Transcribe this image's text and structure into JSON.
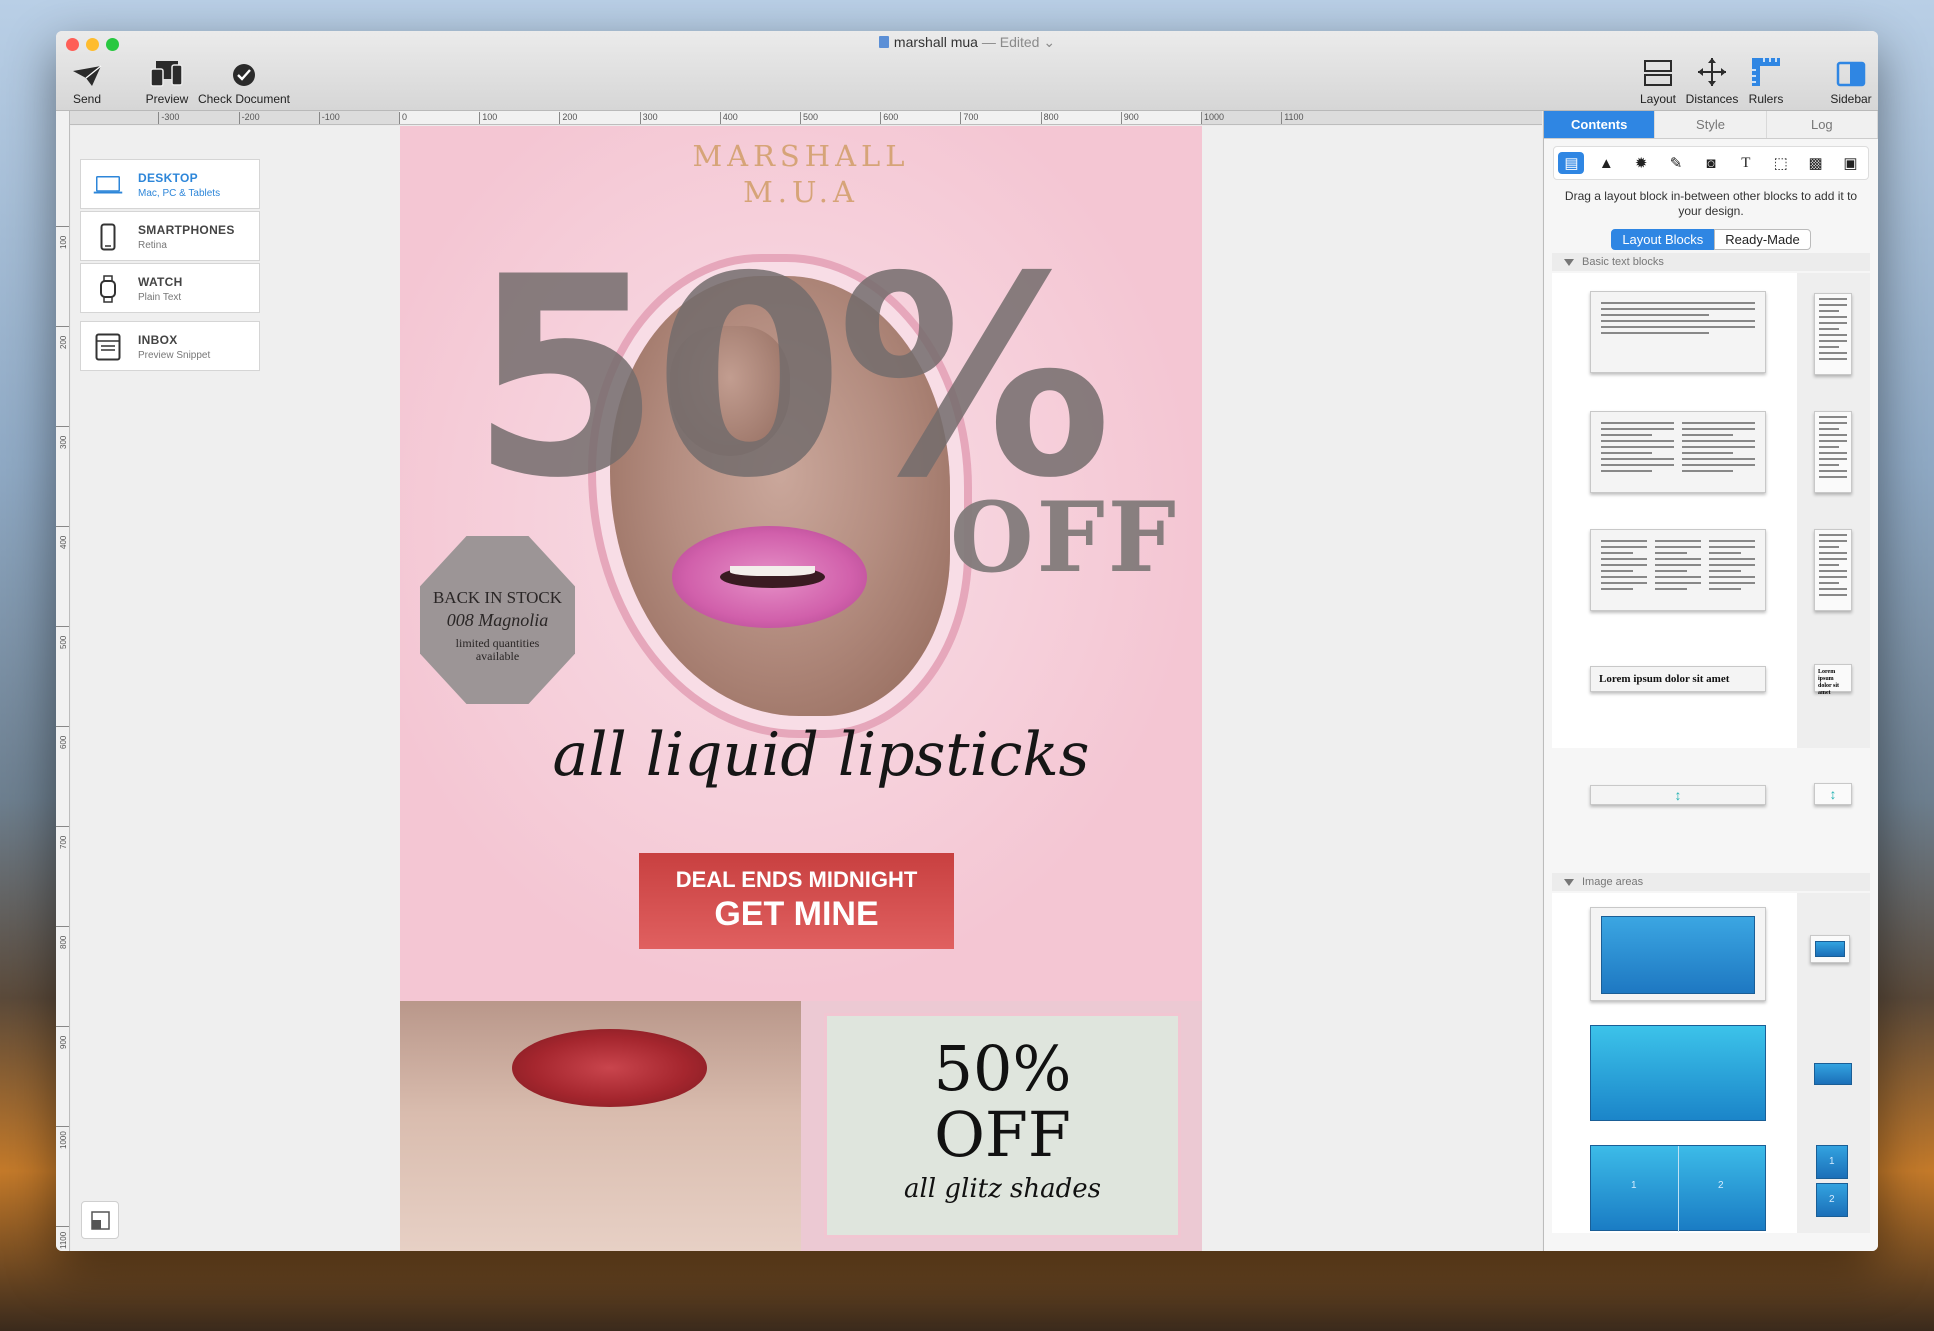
{
  "window": {
    "title": "marshall mua",
    "edited": " — Edited",
    "colors": {
      "close": "#fe5f57",
      "minimize": "#febc2e",
      "zoom": "#28c840",
      "accent": "#2f86e3"
    }
  },
  "toolbar": {
    "left": [
      {
        "label": "Send",
        "icon": "send-icon"
      },
      {
        "label": "Preview",
        "icon": "preview-icon"
      },
      {
        "label": "Check Document",
        "icon": "check-icon"
      }
    ],
    "right": [
      {
        "label": "Layout",
        "icon": "layout-icon"
      },
      {
        "label": "Distances",
        "icon": "distances-icon"
      },
      {
        "label": "Rulers",
        "icon": "rulers-icon"
      },
      {
        "label": "Sidebar",
        "icon": "sidebar-icon"
      }
    ]
  },
  "ruler": {
    "h_ticks": [
      "-300",
      "-200",
      "-100",
      "0",
      "100",
      "200",
      "300",
      "400",
      "500",
      "600",
      "700",
      "800",
      "900",
      "1000",
      "1100"
    ],
    "v_ticks": [
      "100",
      "200",
      "300",
      "400",
      "500",
      "600",
      "700",
      "800",
      "900",
      "1000",
      "1100"
    ]
  },
  "devices": [
    {
      "name": "DESKTOP",
      "sub": "Mac, PC & Tablets",
      "icon": "laptop-icon",
      "active": true
    },
    {
      "name": "SMARTPHONES",
      "sub": "Retina",
      "icon": "smartphone-icon"
    },
    {
      "name": "WATCH",
      "sub": "Plain Text",
      "icon": "watch-icon"
    },
    {
      "name": "INBOX",
      "sub": "Preview Snippet",
      "icon": "inbox-icon"
    }
  ],
  "email": {
    "brand_line1": "MARSHALL",
    "brand_line2": "M.U.A",
    "big_percent": "50%",
    "off": "OFF",
    "badge_line1": "BACK IN STOCK",
    "badge_line2": "008 Magnolia",
    "badge_line3": "limited quantities",
    "badge_line4": "available",
    "script": "all liquid lipsticks",
    "cta_line1": "DEAL ENDS MIDNIGHT",
    "cta_line2": "GET MINE",
    "promo_line1": "50%",
    "promo_line2": "OFF",
    "promo_line3": "all glitz shades"
  },
  "sidebar": {
    "tabs": [
      "Contents",
      "Style",
      "Log"
    ],
    "icons": [
      "layout-block-icon",
      "shape-icon",
      "badge-icon",
      "brush-icon",
      "image-icon",
      "text-icon",
      "selection-icon",
      "pattern-icon",
      "picture-icon"
    ],
    "help": "Drag a layout block in-between other blocks to add it to your design.",
    "segments": [
      "Layout Blocks",
      "Ready-Made"
    ],
    "section1": "Basic text blocks",
    "section2": "Image areas",
    "lorem": "Lorem ipsum dolor sit amet",
    "lorem_small_1": "Lorem ipsum",
    "lorem_small_2": "dolor sit amet",
    "split_labels": [
      "1",
      "2"
    ]
  }
}
